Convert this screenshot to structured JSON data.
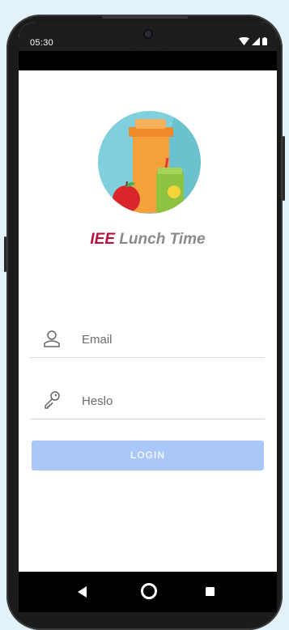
{
  "status_bar": {
    "time": "05:30",
    "icons": [
      "wifi-icon",
      "signal-icon",
      "battery-icon"
    ]
  },
  "logo": {
    "accent_text": "IEE",
    "name_text": " Lunch Time",
    "accent_color": "#b4123c"
  },
  "form": {
    "email_placeholder": "Email",
    "password_placeholder": "Heslo",
    "email_icon": "person-icon",
    "password_icon": "key-icon"
  },
  "login_button": {
    "label": "LOGIN",
    "color": "#a9c7f9"
  },
  "nav_bar": {
    "icons": [
      "back-icon",
      "home-icon",
      "recents-icon"
    ]
  }
}
